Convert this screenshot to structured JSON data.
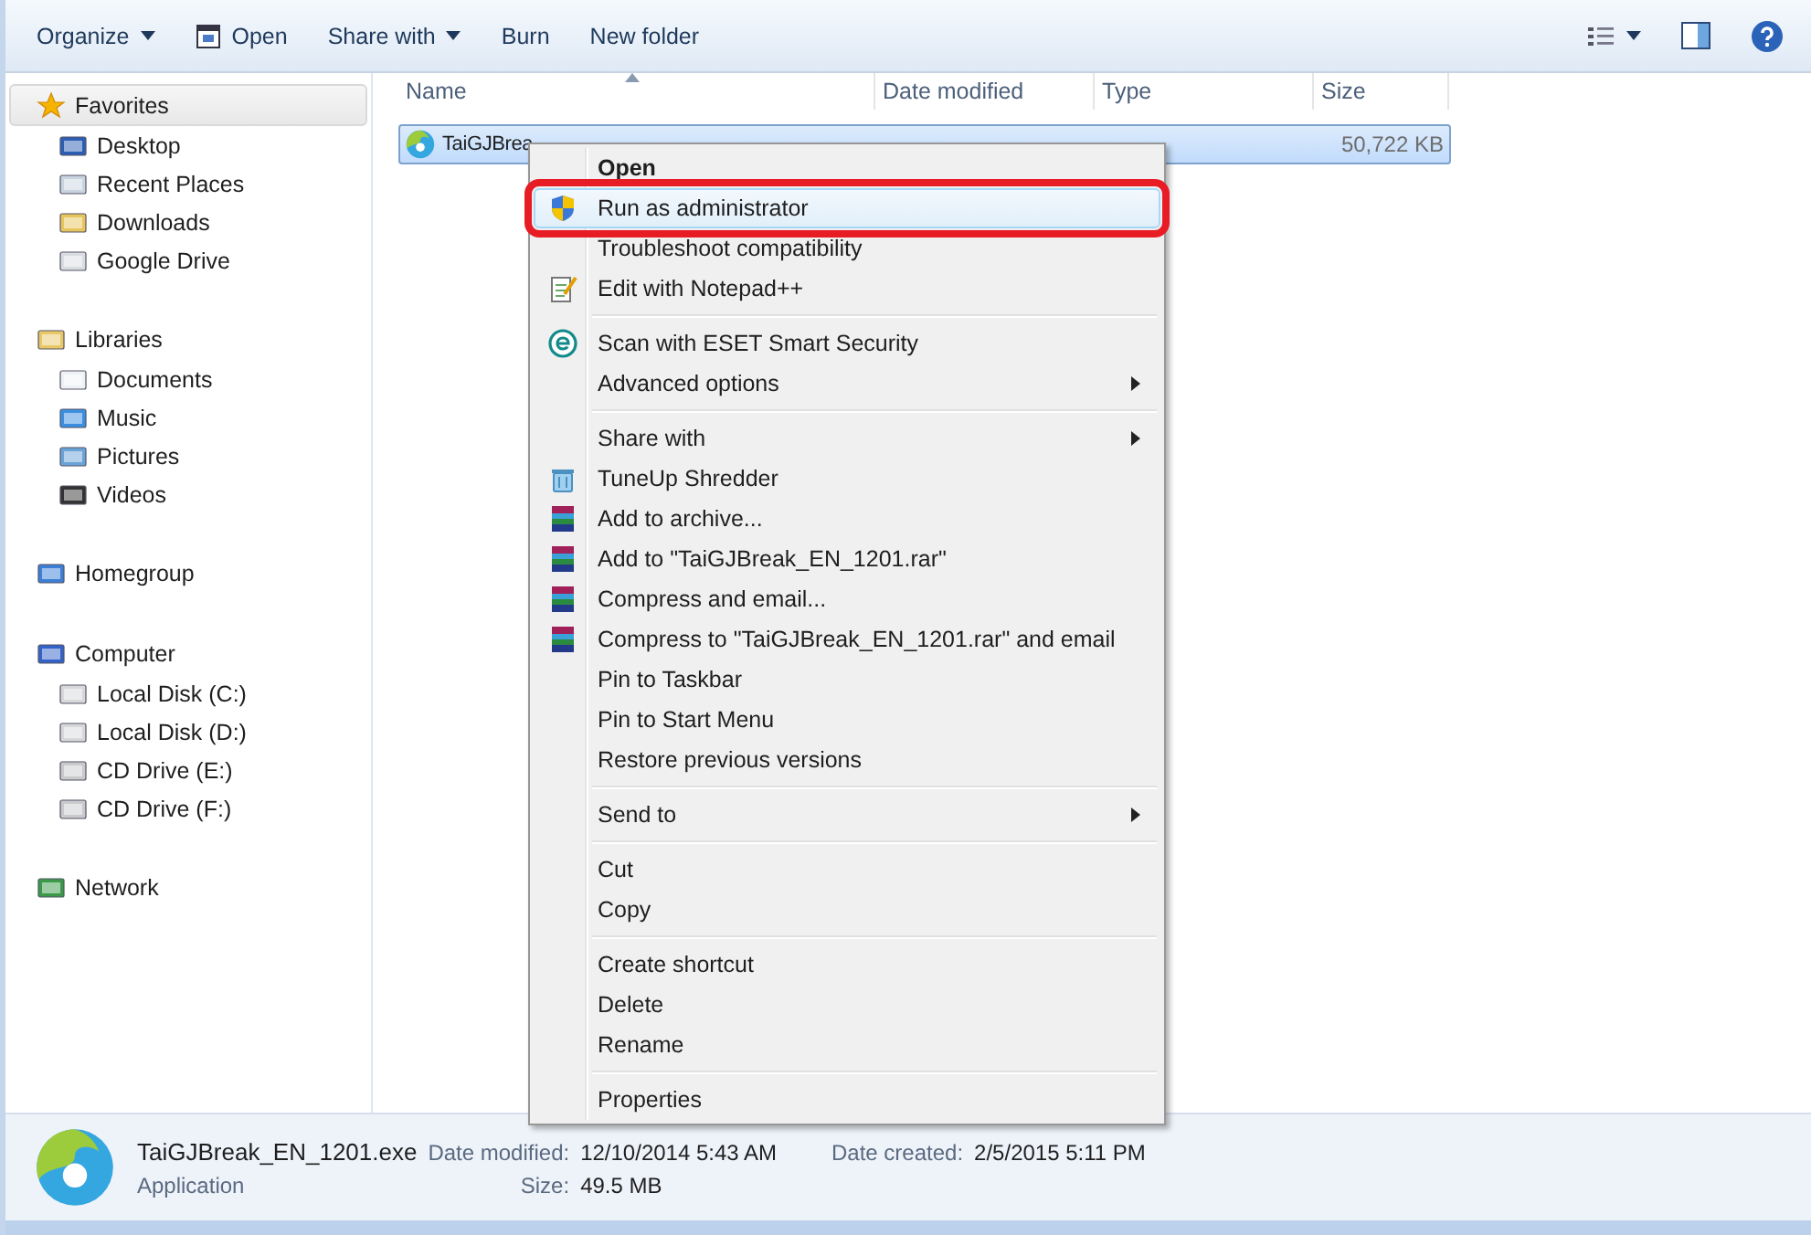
{
  "toolbar": {
    "buttons": [
      {
        "label": "Organize",
        "caret": true
      },
      {
        "label": "Open",
        "caret": false
      },
      {
        "label": "Share with",
        "caret": true
      },
      {
        "label": "Burn",
        "caret": false
      },
      {
        "label": "New folder",
        "caret": false
      }
    ]
  },
  "sidebar": {
    "groups": [
      {
        "label": "Favorites",
        "selected": true,
        "children": [
          {
            "label": "Desktop"
          },
          {
            "label": "Recent Places"
          },
          {
            "label": "Downloads"
          },
          {
            "label": "Google Drive"
          }
        ]
      },
      {
        "label": "Libraries",
        "selected": false,
        "children": [
          {
            "label": "Documents"
          },
          {
            "label": "Music"
          },
          {
            "label": "Pictures"
          },
          {
            "label": "Videos"
          }
        ]
      },
      {
        "label": "Homegroup",
        "selected": false
      },
      {
        "label": "Computer",
        "selected": false,
        "children": [
          {
            "label": "Local Disk (C:)"
          },
          {
            "label": "Local Disk (D:)"
          },
          {
            "label": "CD Drive (E:)"
          },
          {
            "label": "CD Drive (F:)"
          }
        ]
      },
      {
        "label": "Network",
        "selected": false
      }
    ]
  },
  "table": {
    "columns": [
      "Name",
      "Date modified",
      "Type",
      "Size"
    ],
    "rows": [
      {
        "name": "TaiGJBrea",
        "size": "50,722 KB",
        "selected": true
      }
    ]
  },
  "context_menu": {
    "groups": [
      [
        {
          "label": "Open",
          "bold": true,
          "submenu": false,
          "selected": false
        },
        {
          "label": "Run as administrator",
          "bold": false,
          "submenu": false,
          "selected": true
        },
        {
          "label": "Troubleshoot compatibility",
          "bold": false,
          "submenu": false,
          "selected": false
        },
        {
          "label": "Edit with Notepad++",
          "bold": false,
          "submenu": false,
          "selected": false
        }
      ],
      [
        {
          "label": "Scan with ESET Smart Security",
          "bold": false,
          "submenu": false,
          "selected": false
        },
        {
          "label": "Advanced options",
          "bold": false,
          "submenu": true,
          "selected": false
        }
      ],
      [
        {
          "label": "Share with",
          "bold": false,
          "submenu": true,
          "selected": false
        },
        {
          "label": "TuneUp Shredder",
          "bold": false,
          "submenu": false,
          "selected": false
        },
        {
          "label": "Add to archive...",
          "bold": false,
          "submenu": false,
          "selected": false
        },
        {
          "label": "Add to \"TaiGJBreak_EN_1201.rar\"",
          "bold": false,
          "submenu": false,
          "selected": false
        },
        {
          "label": "Compress and email...",
          "bold": false,
          "submenu": false,
          "selected": false
        },
        {
          "label": "Compress to \"TaiGJBreak_EN_1201.rar\" and email",
          "bold": false,
          "submenu": false,
          "selected": false
        },
        {
          "label": "Pin to Taskbar",
          "bold": false,
          "submenu": false,
          "selected": false
        },
        {
          "label": "Pin to Start Menu",
          "bold": false,
          "submenu": false,
          "selected": false
        },
        {
          "label": "Restore previous versions",
          "bold": false,
          "submenu": false,
          "selected": false
        }
      ],
      [
        {
          "label": "Send to",
          "bold": false,
          "submenu": true,
          "selected": false
        }
      ],
      [
        {
          "label": "Cut",
          "bold": false,
          "submenu": false,
          "selected": false
        },
        {
          "label": "Copy",
          "bold": false,
          "submenu": false,
          "selected": false
        }
      ],
      [
        {
          "label": "Create shortcut",
          "bold": false,
          "submenu": false,
          "selected": false
        },
        {
          "label": "Delete",
          "bold": false,
          "submenu": false,
          "selected": false
        },
        {
          "label": "Rename",
          "bold": false,
          "submenu": false,
          "selected": false
        }
      ],
      [
        {
          "label": "Properties",
          "bold": false,
          "submenu": false,
          "selected": false
        }
      ]
    ]
  },
  "details_pane": {
    "filename": "TaiGJBreak_EN_1201.exe",
    "type": "Application",
    "fields": [
      {
        "label": "Date modified:",
        "value": "12/10/2014 5:43 AM"
      },
      {
        "label": "Date created:",
        "value": "2/5/2015 5:11 PM"
      },
      {
        "label": "Size:",
        "value": "49.5 MB"
      }
    ]
  }
}
